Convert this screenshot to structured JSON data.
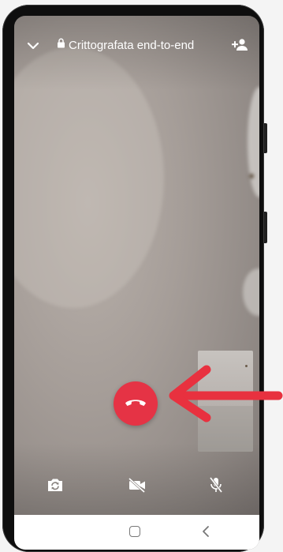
{
  "call": {
    "title": "Crittografata end-to-end",
    "lock_icon": "lock-icon",
    "collapse_icon": "chevron-down-icon",
    "add_participant_icon": "add-person-icon"
  },
  "controls": {
    "flip_camera_icon": "flip-camera-icon",
    "video_off_icon": "video-off-icon",
    "mute_icon": "mic-off-icon",
    "end_call_icon": "phone-hangup-icon"
  },
  "navigation": {
    "home_icon": "home-square-icon",
    "back_icon": "back-chevron-icon"
  },
  "colors": {
    "end_call": "#e53345",
    "arrow": "#e8313f",
    "icon": "#ffffff"
  }
}
